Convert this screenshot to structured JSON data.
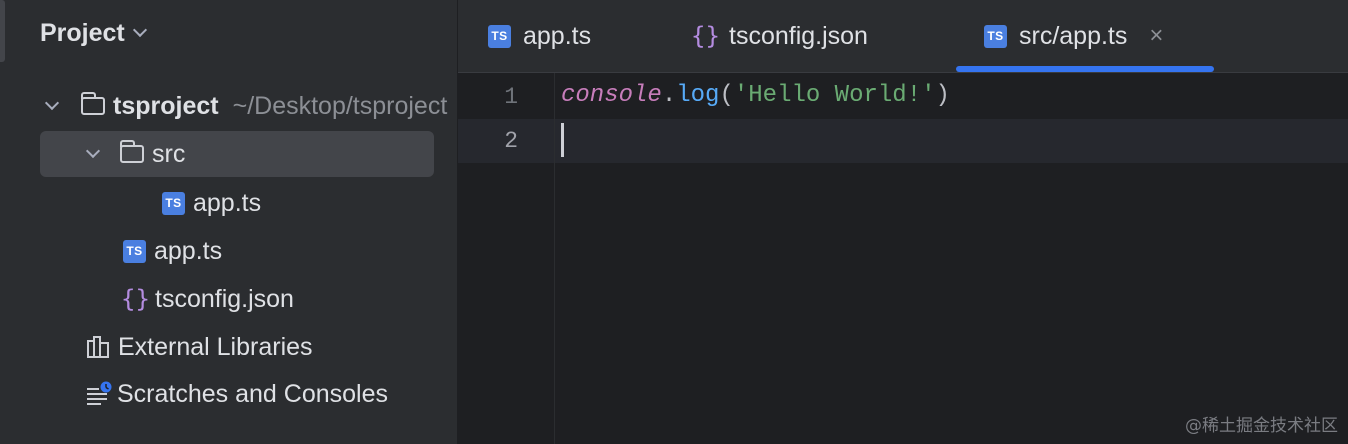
{
  "project_panel": {
    "title": "Project",
    "tree": {
      "root": {
        "name": "tsproject",
        "path": "~/Desktop/tsproject"
      },
      "src_folder": "src",
      "src_app_ts": "app.ts",
      "app_ts": "app.ts",
      "tsconfig": "tsconfig.json",
      "external_libraries": "External Libraries",
      "scratches": "Scratches and Consoles"
    }
  },
  "tabs": [
    {
      "label": "app.ts",
      "icon": "ts-file-icon"
    },
    {
      "label": "tsconfig.json",
      "icon": "json-file-icon"
    },
    {
      "label": "src/app.ts",
      "icon": "ts-file-icon",
      "active": true,
      "close": "×"
    }
  ],
  "editor": {
    "line_numbers": [
      "1",
      "2"
    ],
    "code": {
      "object": "console",
      "dot": ".",
      "method": "log",
      "open_paren": "(",
      "string": "'Hello World!'",
      "close_paren": ")"
    }
  },
  "icon_labels": {
    "ts": "TS",
    "json": "{}"
  },
  "watermark": "@稀土掘金技术社区",
  "colors": {
    "accent": "#3574f0",
    "ts_icon": "#4a7fe0",
    "json_icon": "#b48ce0",
    "string": "#6aab73",
    "method": "#57aaf7",
    "object": "#c77dbb"
  }
}
